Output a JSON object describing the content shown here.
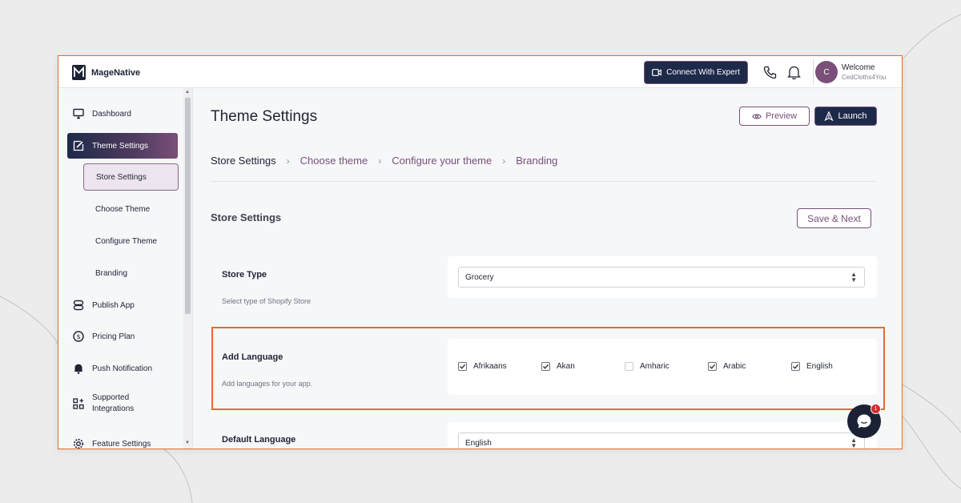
{
  "app": {
    "name": "MageNative"
  },
  "header": {
    "expert_button": "Connect With Expert",
    "welcome": "Welcome",
    "store_name": "CedCloths4You",
    "avatar_initial": "C"
  },
  "sidebar": {
    "items": [
      {
        "label": "Dashboard",
        "icon": "monitor-icon"
      },
      {
        "label": "Theme Settings",
        "icon": "paint-brush-icon"
      },
      {
        "label": "Publish App",
        "icon": "publish-icon"
      },
      {
        "label": "Pricing Plan",
        "icon": "dollar-icon"
      },
      {
        "label": "Push Notification",
        "icon": "bell-icon"
      },
      {
        "label": "Supported Integrations",
        "icon": "grid-plus-icon"
      },
      {
        "label": "Feature Settings",
        "icon": "gear-icon"
      }
    ],
    "sub_items": [
      "Store Settings",
      "Choose Theme",
      "Configure Theme",
      "Branding"
    ]
  },
  "main": {
    "title": "Theme Settings",
    "preview_button": "Preview",
    "launch_button": "Launch",
    "breadcrumb": [
      "Store Settings",
      "Choose theme",
      "Configure your theme",
      "Branding"
    ],
    "section_title": "Store Settings",
    "save_button": "Save & Next",
    "store_type": {
      "label": "Store Type",
      "help": "Select type of Shopify Store",
      "value": "Grocery"
    },
    "add_language": {
      "label": "Add Language",
      "help": "Add languages for your app.",
      "options": [
        {
          "label": "Afrikaans",
          "checked": true
        },
        {
          "label": "Akan",
          "checked": true
        },
        {
          "label": "Amharic",
          "checked": false
        },
        {
          "label": "Arabic",
          "checked": true
        },
        {
          "label": "English",
          "checked": true
        }
      ]
    },
    "default_language": {
      "label": "Default Language",
      "value": "English"
    }
  },
  "chat": {
    "badge": "1"
  },
  "colors": {
    "accent": "#7a4f79",
    "navy": "#1e2a4a",
    "highlight": "#e8692e"
  }
}
